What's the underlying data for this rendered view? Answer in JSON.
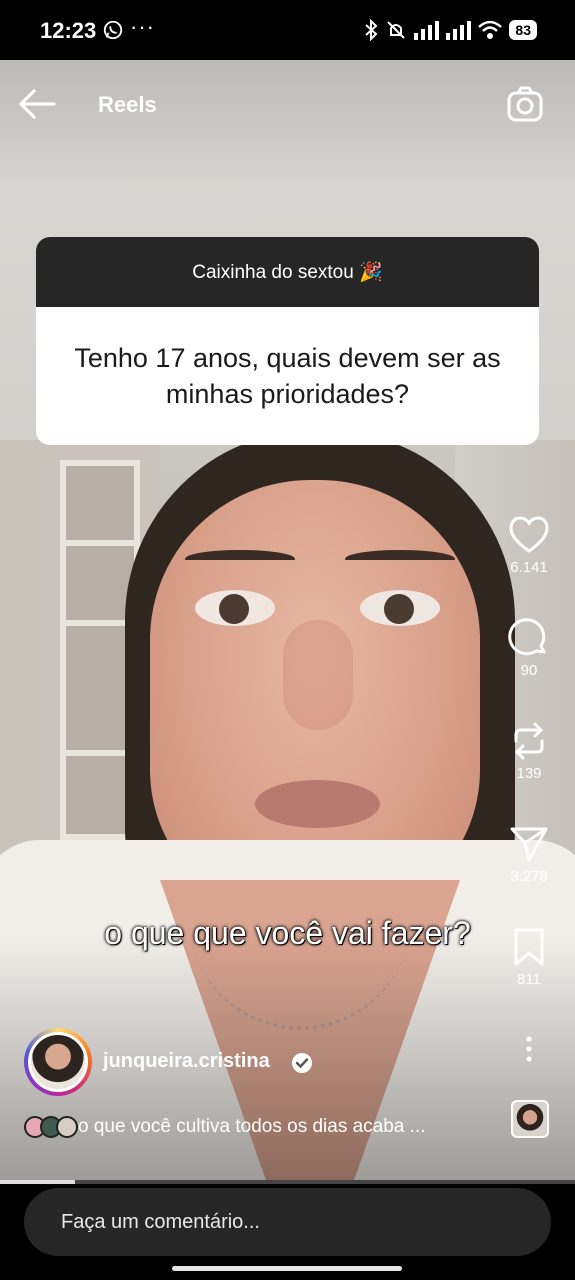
{
  "status_bar": {
    "time": "12:23",
    "overflow": "···",
    "battery": "83"
  },
  "header": {
    "title": "Reels"
  },
  "question_sticker": {
    "heading": "Caixinha do sextou 🎉",
    "question": "Tenho 17 anos, quais devem ser as minhas prioridades?"
  },
  "actions": {
    "likes": "6.141",
    "comments": "90",
    "reposts": "139",
    "shares": "3.278",
    "saves": "811"
  },
  "caption": "o que que você vai fazer?",
  "author": {
    "username": "junqueira.cristina"
  },
  "description": "o que você cultiva todos os dias acaba ...",
  "comment_placeholder": "Faça um comentário...",
  "icons": [
    "whatsapp-icon",
    "bluetooth-icon",
    "mute-icon",
    "signal-icon",
    "wifi-icon",
    "battery-icon",
    "back-arrow-icon",
    "camera-icon",
    "heart-icon",
    "comment-icon",
    "repost-icon",
    "send-icon",
    "bookmark-icon",
    "more-icon",
    "verified-icon"
  ]
}
